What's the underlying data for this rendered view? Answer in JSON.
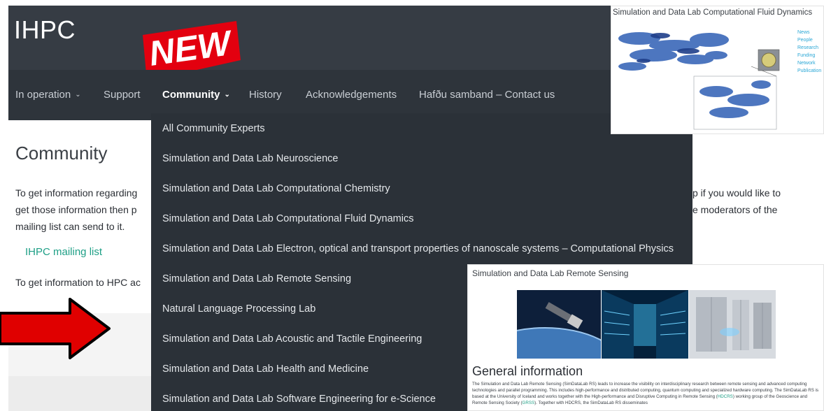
{
  "header": {
    "logo": "IHPC",
    "new_badge": "NEW"
  },
  "nav": {
    "items": [
      {
        "label": "In operation",
        "caret": "⌄"
      },
      {
        "label": "Support"
      },
      {
        "label": "Community",
        "caret": "⌄"
      },
      {
        "label": "History"
      },
      {
        "label": "Acknowledgements"
      },
      {
        "label": "Hafðu samband – Contact us"
      }
    ]
  },
  "dropdown": {
    "items": [
      "All Community Experts",
      "Simulation and Data Lab Neuroscience",
      "Simulation and Data Lab Computational Chemistry",
      "Simulation and Data Lab Computational Fluid Dynamics",
      "Simulation and Data Lab Electron, optical and transport properties of nanoscale systems – Computational Physics",
      "Simulation and Data Lab Remote Sensing",
      "Natural Language Processing Lab",
      "Simulation and Data Lab Acoustic and Tactile Engineering",
      "Simulation and Data Lab Health and Medicine",
      "Simulation and Data Lab Software Engineering for e-Science"
    ]
  },
  "page": {
    "title": "Community",
    "para1_line1_left": "To get information regarding",
    "para1_line2_left": "get those information then p",
    "para1_line3": "mailing list can send to it.",
    "para1_line1_right": "p if you would like to",
    "para1_line2_right": "e moderators of the",
    "mailing_list_link": "IHPC mailing list",
    "para2_left": "To get information to HPC ac"
  },
  "inset_cfd": {
    "caption": "Simulation and Data Lab Computational Fluid Dynamics",
    "links": [
      "News",
      "People",
      "Research",
      "Funding",
      "Network",
      "Publication"
    ]
  },
  "inset_rs": {
    "caption": "Simulation and Data Lab Remote Sensing",
    "heading": "General information",
    "text_1": "The Simulation and Data Lab Remote Sensing (SimDataLab RS) leads to increase the visibility on interdisciplinary research between remote sensing and advanced computing technologies and parallel programming. This includes high-performance and distributed computing, quantum computing and specialized hardware computing. The SimDataLab RS is based at the University of Iceland and works together with the High-performance and Disruptive Computing in Remote Sensing (",
    "link_1": "HDCRS",
    "text_2": ") working group of the Geoscience and Remote Sensing Society (",
    "link_2": "GRSS",
    "text_3": "). Together with HDCRS, the SimDataLab RS disseminates"
  },
  "colors": {
    "header_bg": "#363c44",
    "nav_bg": "#2e343b",
    "dropdown_bg": "#2b3138",
    "link": "#1e9f86",
    "arrow": "#e00000",
    "badge": "#e3000f"
  }
}
